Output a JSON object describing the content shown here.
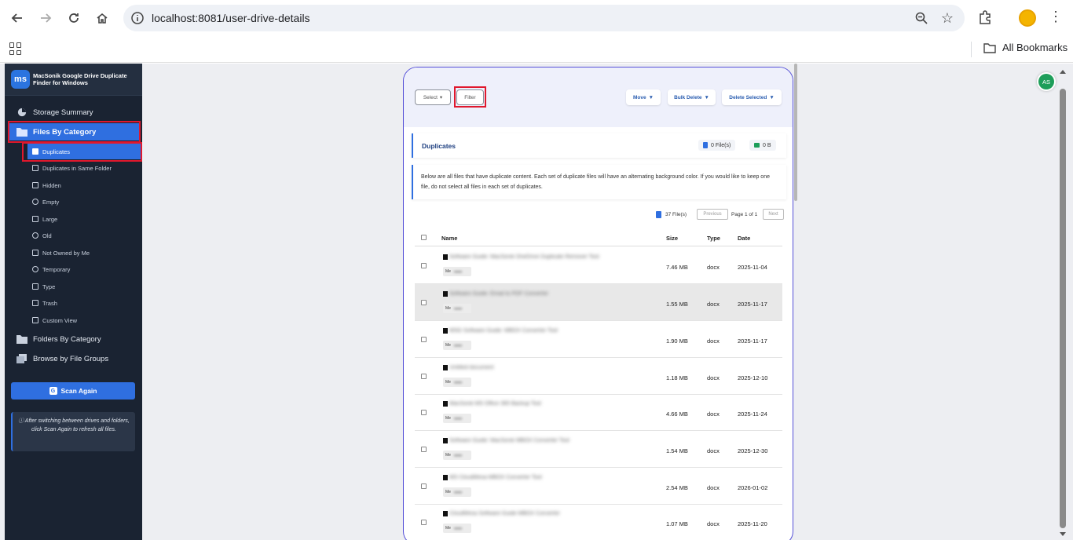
{
  "browser": {
    "url": "localhost:8081/user-drive-details",
    "bookmarks_label": "All Bookmarks"
  },
  "sidebar": {
    "brand": "MacSonik Google Drive Duplicate Finder for Windows",
    "logo_text": "ms",
    "items": [
      {
        "label": "Storage Summary"
      },
      {
        "label": "Files By Category"
      },
      {
        "label": "Folders By Category"
      },
      {
        "label": "Browse by File Groups"
      }
    ],
    "sub_items": [
      {
        "label": "Duplicates"
      },
      {
        "label": "Duplicates in Same Folder"
      },
      {
        "label": "Hidden"
      },
      {
        "label": "Empty"
      },
      {
        "label": "Large"
      },
      {
        "label": "Old"
      },
      {
        "label": "Not Owned by Me"
      },
      {
        "label": "Temporary"
      },
      {
        "label": "Type"
      },
      {
        "label": "Trash"
      },
      {
        "label": "Custom View"
      }
    ],
    "scan_button": "Scan Again",
    "note": "After switching between drives and folders, click Scan Again to refresh all files."
  },
  "toolbar": {
    "select": "Select",
    "filter": "Filter",
    "move": "Move",
    "bulk_delete": "Bulk Delete",
    "delete_selected": "Delete Selected"
  },
  "duplicates": {
    "title": "Duplicates",
    "files_count": "0 File(s)",
    "size": "0 B",
    "info": "Below are all files that have duplicate content. Each set of duplicate files will have an alternating background color. If you would like to keep one file, do not select all files in each set of duplicates."
  },
  "pager": {
    "total": "37 File(s)",
    "previous": "Previous",
    "page": "Page 1 of 1",
    "next": "Next"
  },
  "table": {
    "headers": {
      "name": "Name",
      "size": "Size",
      "type": "Type",
      "date": "Date"
    },
    "rows": [
      {
        "name": "Software Guide: MacSonik OneDrive Duplicate Remover Tool",
        "owner": "Me",
        "size": "7.46 MB",
        "type": "docx",
        "date": "2025-11-04"
      },
      {
        "name": "Software Guide: Email to PDF Converter",
        "owner": "Me",
        "size": "1.55 MB",
        "type": "docx",
        "date": "2025-11-17"
      },
      {
        "name": "MSG Software Guide: MBOX Converter Tool",
        "owner": "Me",
        "size": "1.90 MB",
        "type": "docx",
        "date": "2025-11-17"
      },
      {
        "name": "Untitled document",
        "owner": "Me",
        "size": "1.18 MB",
        "type": "docx",
        "date": "2025-12-10"
      },
      {
        "name": "MacSonik MS Office 365 Backup Tool",
        "owner": "Me",
        "size": "4.66 MB",
        "type": "docx",
        "date": "2025-11-24"
      },
      {
        "name": "Software Guide: MacSonik MBOX Converter Tool",
        "owner": "Me",
        "size": "1.54 MB",
        "type": "docx",
        "date": "2025-12-30"
      },
      {
        "name": "MS CloudMesa MBOX Converter Tool",
        "owner": "Me",
        "size": "2.54 MB",
        "type": "docx",
        "date": "2026-01-02"
      },
      {
        "name": "CloudMesa Software Guide MBOX Converter",
        "owner": "Me",
        "size": "1.07 MB",
        "type": "docx",
        "date": "2025-11-20"
      }
    ]
  },
  "user": {
    "initials": "AS"
  }
}
